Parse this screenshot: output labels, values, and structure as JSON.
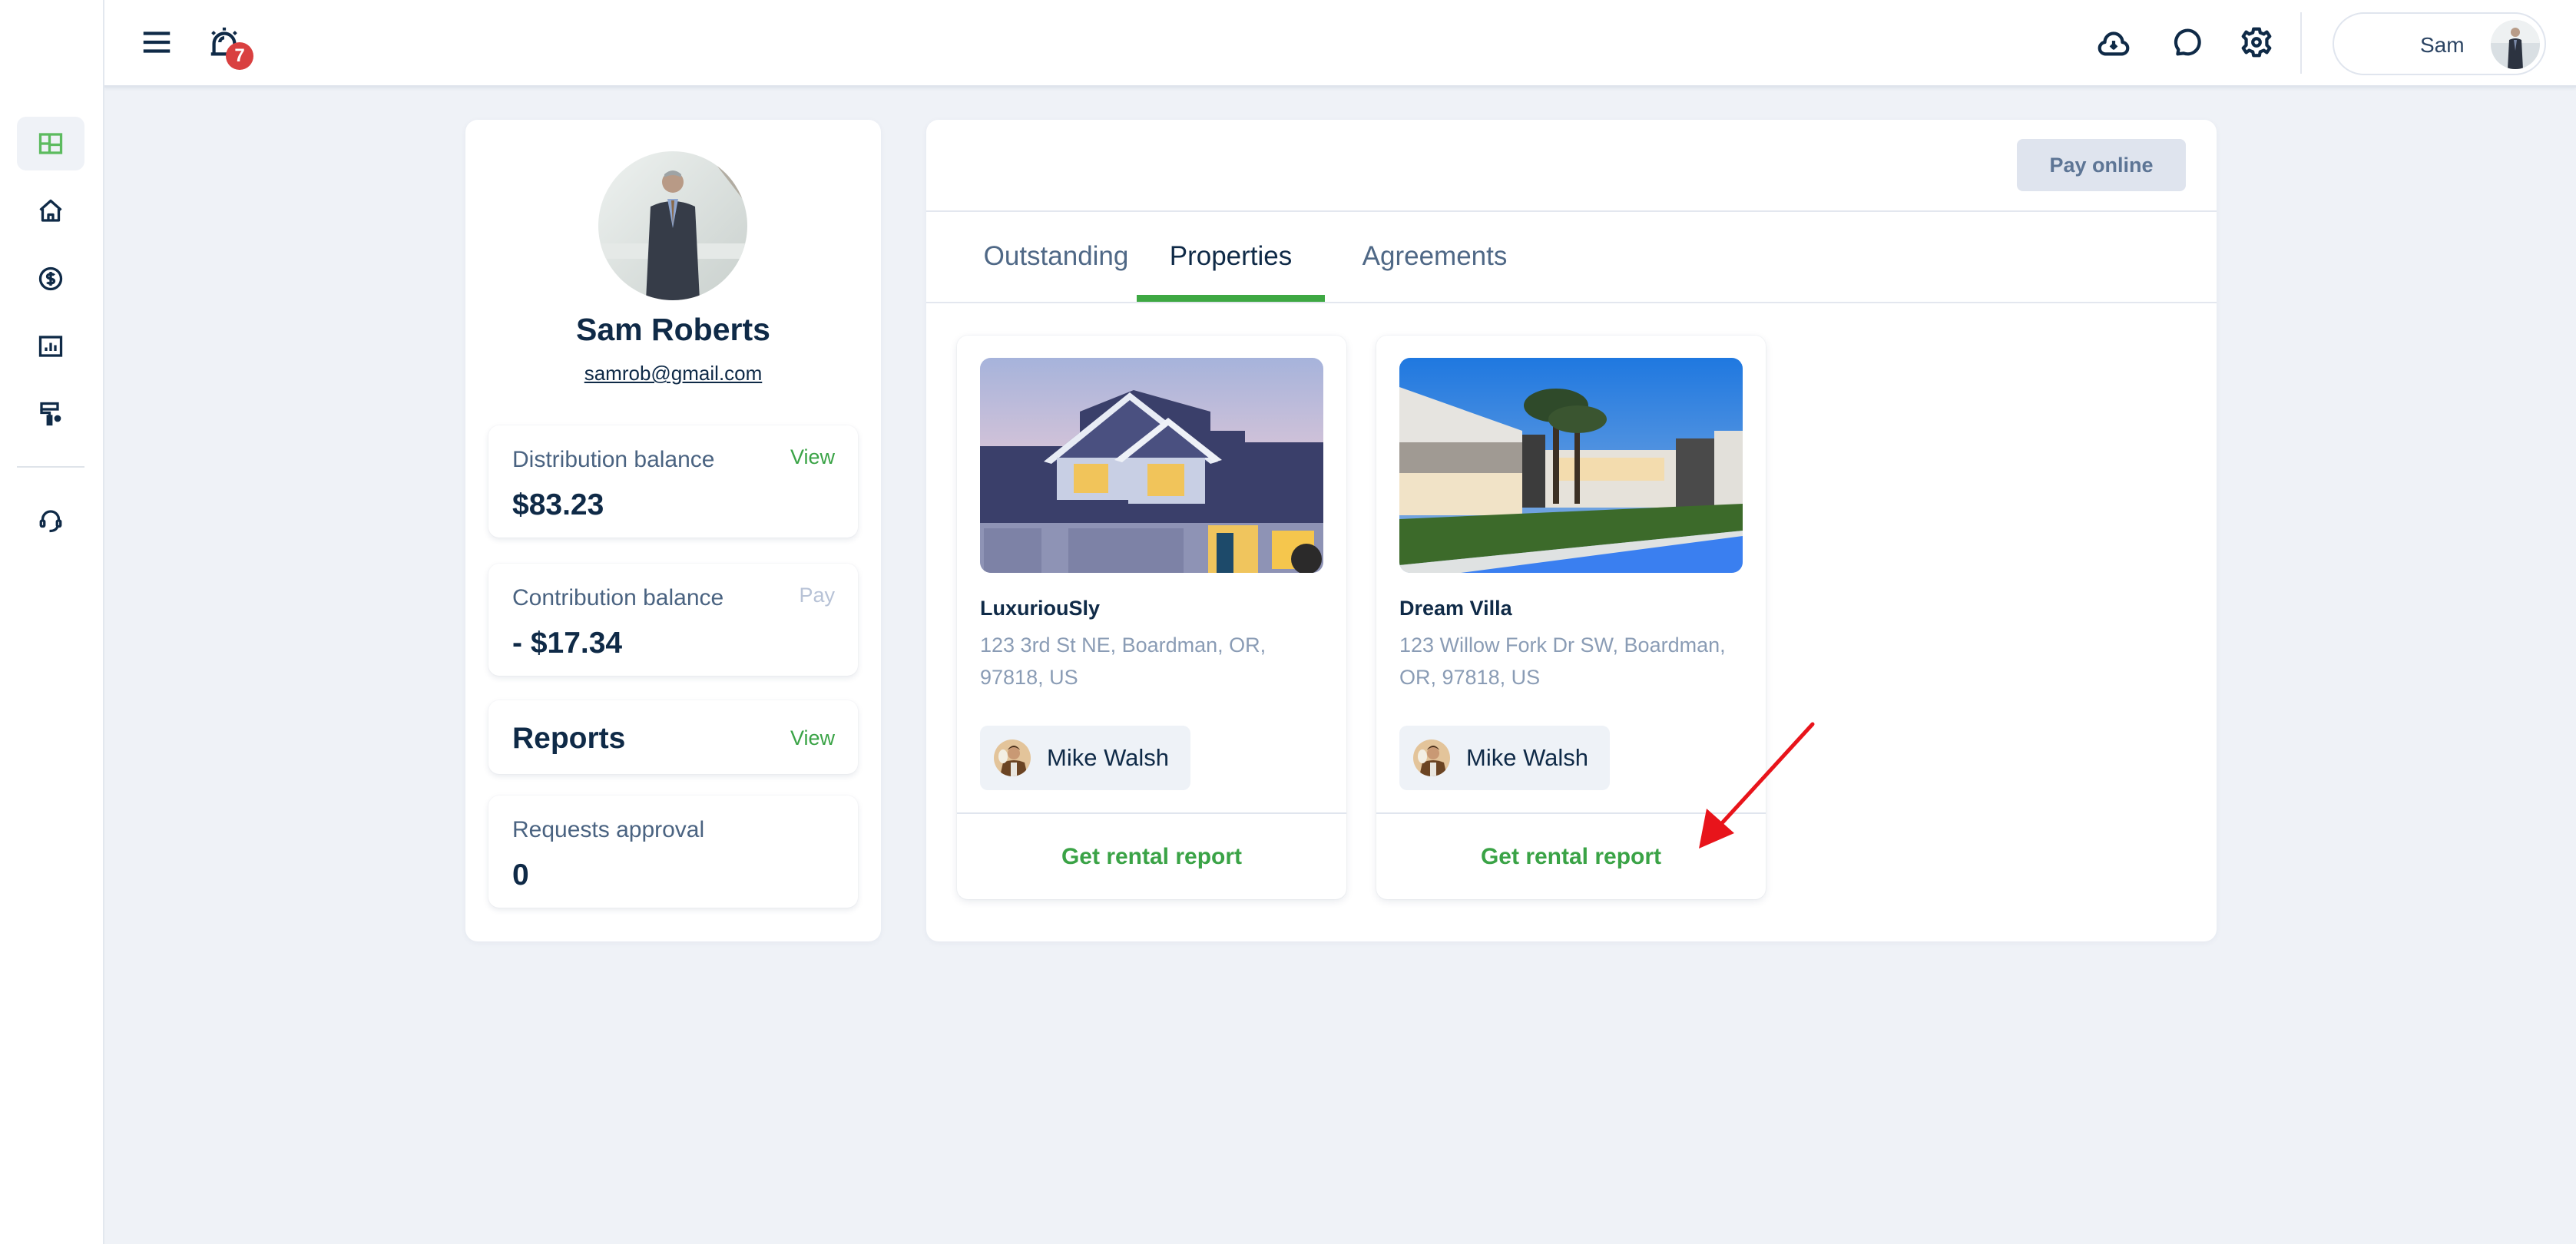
{
  "sidebar": {
    "items": [
      {
        "name": "dashboard",
        "icon": "dashboard-grid-icon",
        "active": true
      },
      {
        "name": "home",
        "icon": "home-icon",
        "active": false
      },
      {
        "name": "payments",
        "icon": "dollar-circle-icon",
        "active": false
      },
      {
        "name": "reports",
        "icon": "bar-chart-icon",
        "active": false
      },
      {
        "name": "maintenance",
        "icon": "paint-roller-icon",
        "active": false
      },
      {
        "name": "support",
        "icon": "headset-icon",
        "active": false
      }
    ],
    "accent": "#5cbb5f"
  },
  "header": {
    "menu_icon": "hamburger-menu-icon",
    "alerts_icon": "alarm-bell-icon",
    "alerts_count": "7",
    "actions": [
      "cloud-download-icon",
      "chat-bubble-icon",
      "gear-icon"
    ],
    "user_name": "Sam"
  },
  "profile": {
    "name": "Sam Roberts",
    "email": "samrob@gmail.com",
    "distribution": {
      "label": "Distribution balance",
      "value": "$83.23",
      "action": "View"
    },
    "contribution": {
      "label": "Contribution balance",
      "value": "- $17.34",
      "action": "Pay"
    },
    "reports": {
      "label": "Reports",
      "action": "View"
    },
    "requests": {
      "label": "Requests approval",
      "value": "0"
    }
  },
  "main": {
    "pay_online_label": "Pay online",
    "tabs": [
      {
        "label": "Outstanding",
        "active": false
      },
      {
        "label": "Properties",
        "active": true
      },
      {
        "label": "Agreements",
        "active": false
      }
    ],
    "properties": [
      {
        "name": "LuxuriouSly",
        "address": "123 3rd St NE, Boardman, OR, 97818, US",
        "agent": "Mike Walsh",
        "action": "Get rental report"
      },
      {
        "name": "Dream Villa",
        "address": "123 Willow Fork Dr SW, Boardman, OR, 97818, US",
        "agent": "Mike Walsh",
        "action": "Get rental report"
      }
    ]
  },
  "colors": {
    "primary_text": "#0f2a47",
    "accent_green": "#3aa346",
    "badge_red": "#d94040",
    "annotation_red": "#e8141b"
  }
}
